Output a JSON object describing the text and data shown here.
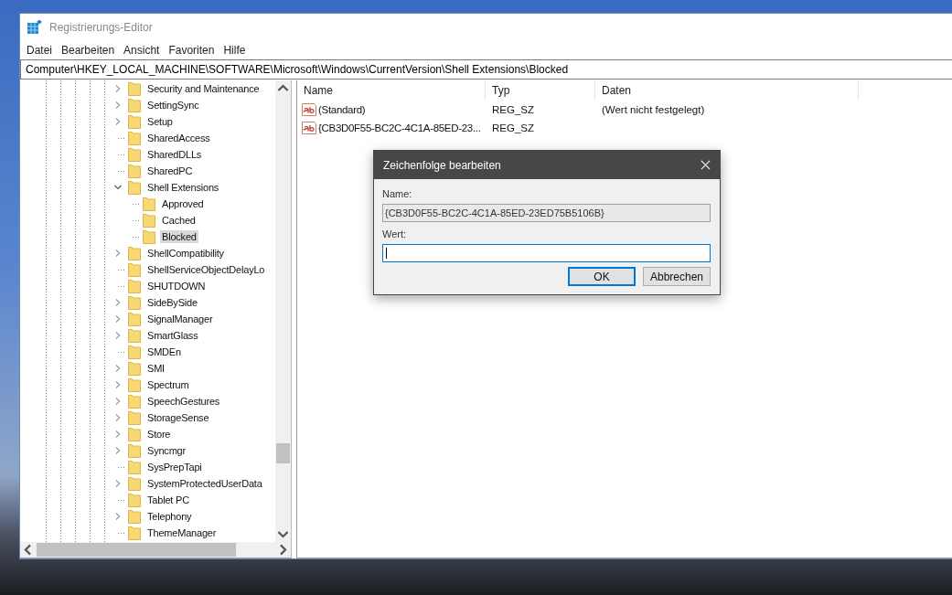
{
  "window": {
    "title": "Registrierungs-Editor"
  },
  "menu": [
    "Datei",
    "Bearbeiten",
    "Ansicht",
    "Favoriten",
    "Hilfe"
  ],
  "address": "Computer\\HKEY_LOCAL_MACHINE\\SOFTWARE\\Microsoft\\Windows\\CurrentVersion\\Shell Extensions\\Blocked",
  "tree": [
    {
      "name": "Security and Maintenance",
      "kind": "node",
      "expanded": false,
      "selected": false
    },
    {
      "name": "SettingSync",
      "kind": "node",
      "expanded": false,
      "selected": false
    },
    {
      "name": "Setup",
      "kind": "node",
      "expanded": false,
      "selected": false
    },
    {
      "name": "SharedAccess",
      "kind": "leaf",
      "selected": false
    },
    {
      "name": "SharedDLLs",
      "kind": "leaf",
      "selected": false
    },
    {
      "name": "SharedPC",
      "kind": "leaf",
      "selected": false
    },
    {
      "name": "Shell Extensions",
      "kind": "node",
      "expanded": true,
      "selected": false,
      "children": [
        {
          "name": "Approved",
          "kind": "leaf",
          "selected": false
        },
        {
          "name": "Cached",
          "kind": "leaf",
          "selected": false
        },
        {
          "name": "Blocked",
          "kind": "leaf",
          "selected": true
        }
      ]
    },
    {
      "name": "ShellCompatibility",
      "kind": "node",
      "expanded": false,
      "selected": false
    },
    {
      "name": "ShellServiceObjectDelayLo",
      "kind": "leaf",
      "selected": false
    },
    {
      "name": "SHUTDOWN",
      "kind": "leaf",
      "selected": false
    },
    {
      "name": "SideBySide",
      "kind": "node",
      "expanded": false,
      "selected": false
    },
    {
      "name": "SignalManager",
      "kind": "node",
      "expanded": false,
      "selected": false
    },
    {
      "name": "SmartGlass",
      "kind": "node",
      "expanded": false,
      "selected": false
    },
    {
      "name": "SMDEn",
      "kind": "leaf",
      "selected": false
    },
    {
      "name": "SMI",
      "kind": "node",
      "expanded": false,
      "selected": false
    },
    {
      "name": "Spectrum",
      "kind": "node",
      "expanded": false,
      "selected": false
    },
    {
      "name": "SpeechGestures",
      "kind": "node",
      "expanded": false,
      "selected": false
    },
    {
      "name": "StorageSense",
      "kind": "node",
      "expanded": false,
      "selected": false
    },
    {
      "name": "Store",
      "kind": "node",
      "expanded": false,
      "selected": false
    },
    {
      "name": "Syncmgr",
      "kind": "node",
      "expanded": false,
      "selected": false
    },
    {
      "name": "SysPrepTapi",
      "kind": "leaf",
      "selected": false
    },
    {
      "name": "SystemProtectedUserData",
      "kind": "node",
      "expanded": false,
      "selected": false
    },
    {
      "name": "Tablet PC",
      "kind": "leaf",
      "selected": false
    },
    {
      "name": "Telephony",
      "kind": "node",
      "expanded": false,
      "selected": false
    },
    {
      "name": "ThemeManager",
      "kind": "leaf",
      "selected": false
    }
  ],
  "table": {
    "columns": [
      "Name",
      "Typ",
      "Daten"
    ],
    "rows": [
      {
        "name": "(Standard)",
        "type": "REG_SZ",
        "data": "(Wert nicht festgelegt)"
      },
      {
        "name": "{CB3D0F55-BC2C-4C1A-85ED-23...",
        "type": "REG_SZ"
      }
    ]
  },
  "dialog": {
    "title": "Zeichenfolge bearbeiten",
    "name_label": "Name:",
    "name_value": "{CB3D0F55-BC2C-4C1A-85ED-23ED75B5106B}",
    "value_label": "Wert:",
    "value_focused": true,
    "buttons": [
      {
        "label": "OK",
        "default": true
      },
      {
        "label": "Abbrechen",
        "default": false
      }
    ]
  }
}
